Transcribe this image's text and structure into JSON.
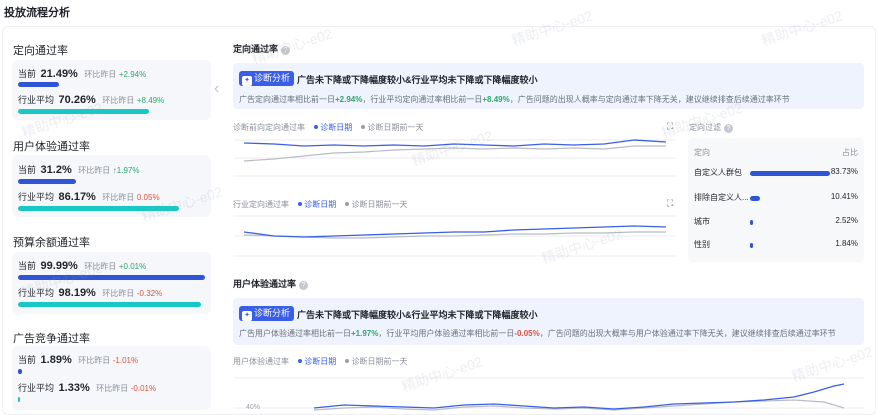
{
  "page": {
    "title": "投放流程分析"
  },
  "metrics": [
    {
      "title": "定向通过率",
      "current": {
        "label": "当前",
        "value": "21.49%",
        "cmp_label": "环比昨日",
        "cmp_value": "+2.94%",
        "direction": "up",
        "fill": 0.22
      },
      "industry": {
        "label": "行业平均",
        "value": "70.26%",
        "cmp_label": "环比昨日",
        "cmp_value": "+8.49%",
        "direction": "up",
        "fill": 0.7
      }
    },
    {
      "title": "用户体验通过率",
      "current": {
        "label": "当前",
        "value": "31.2%",
        "cmp_label": "环比昨日",
        "cmp_value": "↑1.97%",
        "direction": "up",
        "fill": 0.31
      },
      "industry": {
        "label": "行业平均",
        "value": "86.17%",
        "cmp_label": "环比昨日",
        "cmp_value": "0.05%",
        "direction": "down",
        "fill": 0.86
      }
    },
    {
      "title": "预算余额通过率",
      "current": {
        "label": "当前",
        "value": "99.99%",
        "cmp_label": "环比昨日",
        "cmp_value": "+0.01%",
        "direction": "up",
        "fill": 0.9999
      },
      "industry": {
        "label": "行业平均",
        "value": "98.19%",
        "cmp_label": "环比昨日",
        "cmp_value": "-0.32%",
        "direction": "down",
        "fill": 0.98
      }
    },
    {
      "title": "广告竞争通过率",
      "current": {
        "label": "当前",
        "value": "1.89%",
        "cmp_label": "环比昨日",
        "cmp_value": "-1.01%",
        "direction": "down",
        "fill": 0.02
      },
      "industry": {
        "label": "行业平均",
        "value": "1.33%",
        "cmp_label": "环比昨日",
        "cmp_value": "-0.01%",
        "direction": "down",
        "fill": 0.013
      }
    }
  ],
  "targeting": {
    "title": "定向通过率",
    "diag_tag": "诊断分析",
    "headline": "广告未下降或下降幅度较小&行业平均未下降或下降幅度较小",
    "detail_a": "广告定向通过率相比前一日",
    "detail_a_val": "+2.94%",
    "detail_b": "，行业平均定向通过率相比前一日",
    "detail_b_val": "+8.49%",
    "detail_c": "，广告问题的出现人概率与定向通过率下降无关，建议继续排查后续通过率环节",
    "chart1_title": "诊断前向定向通过率",
    "chart2_title": "行业定向通过率",
    "legend_a": "诊断日期",
    "legend_b": "诊断日期前一天",
    "expand_icon": "⛶",
    "filter_title": "定向过滤",
    "table_col_a": "定向",
    "table_col_b": "占比",
    "rows": [
      {
        "name": "自定义人群包",
        "value": "83.73%",
        "share": 0.8373
      },
      {
        "name": "排除自定义人...",
        "value": "10.41%",
        "share": 0.1041
      },
      {
        "name": "城市",
        "value": "2.52%",
        "share": 0.0252
      },
      {
        "name": "性别",
        "value": "1.84%",
        "share": 0.0184
      }
    ]
  },
  "experience": {
    "title": "用户体验通过率",
    "diag_tag": "诊断分析",
    "headline": "广告未下降或下降幅度较小&行业平均未下降或下降幅度较小",
    "detail_a": "广告用户体验通过率相比前一日",
    "detail_a_val": "+1.97%",
    "detail_b": "，行业平均用户体验通过率相比前一日",
    "detail_b_val": "-0.05%",
    "detail_c": "，广告问题的出现大概率与用户体验通过率下降无关，建议继续排查后续通过率环节",
    "chart_title": "用户体验通过率",
    "legend_a": "诊断日期",
    "legend_b": "诊断日期前一天",
    "tick_label": "40%"
  },
  "watermark": "精助中心-e02",
  "colors": {
    "accent": "#3b5ee6",
    "teal": "#17c8c4",
    "up": "#2ea66a",
    "down": "#e0533a"
  },
  "icons": {
    "help": "question-circle-icon",
    "expand": "fullscreen-icon",
    "collapse": "chevron-left-icon",
    "diag": "diagnosis-icon"
  }
}
